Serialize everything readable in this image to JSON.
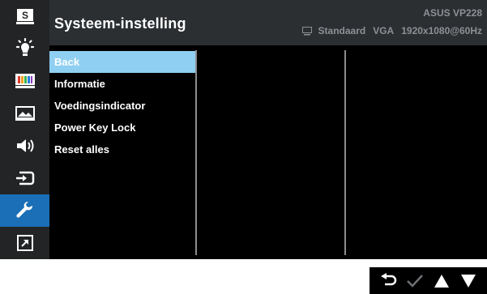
{
  "header": {
    "title": "Systeem-instelling",
    "model": "ASUS  VP228",
    "mode": "Standaard",
    "input": "VGA",
    "resolution": "1920x1080@60Hz"
  },
  "sidebar": {
    "items": [
      {
        "icon": "splendid-icon",
        "glyph": "S"
      },
      {
        "icon": "brightness-icon"
      },
      {
        "icon": "color-icon"
      },
      {
        "icon": "image-icon"
      },
      {
        "icon": "sound-icon"
      },
      {
        "icon": "input-select-icon"
      },
      {
        "icon": "system-setup-icon",
        "active": true
      },
      {
        "icon": "shortcut-icon"
      }
    ]
  },
  "menu": {
    "items": [
      "Back",
      "Informatie",
      "Voedingsindicator",
      "Power Key Lock",
      "Reset alles"
    ],
    "selected_index": 0
  },
  "controls": [
    "back-icon",
    "check-icon",
    "up-arrow-icon",
    "down-arrow-icon"
  ],
  "colors": {
    "accent": "#1a6fb6",
    "highlight": "#8fcff2",
    "sidebar_bg": "#222426",
    "header_bg": "#2c2f32"
  }
}
